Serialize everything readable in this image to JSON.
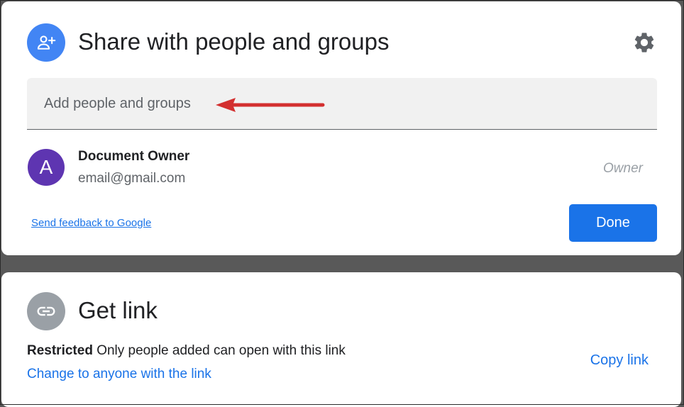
{
  "share": {
    "title": "Share with people and groups",
    "icon": "person-add-icon",
    "settings_icon": "gear-icon",
    "add_field": {
      "placeholder": "Add people and groups",
      "value": ""
    },
    "people": [
      {
        "avatar_letter": "A",
        "avatar_color": "#5e35b1",
        "name": "Document Owner",
        "email": "email@gmail.com",
        "role": "Owner"
      }
    ],
    "feedback_link": "Send feedback to Google",
    "done_label": "Done"
  },
  "link": {
    "title": "Get link",
    "icon": "link-icon",
    "restricted_label": "Restricted",
    "restricted_desc": "Only people added can open with this link",
    "change_link": "Change to anyone with the link",
    "copy_link": "Copy link"
  },
  "colors": {
    "accent": "#1a73e8",
    "share_icon_bg": "#4285f4",
    "link_icon_bg": "#9aa0a6",
    "annotation_arrow": "#d32f2f",
    "backdrop": "#595959"
  }
}
